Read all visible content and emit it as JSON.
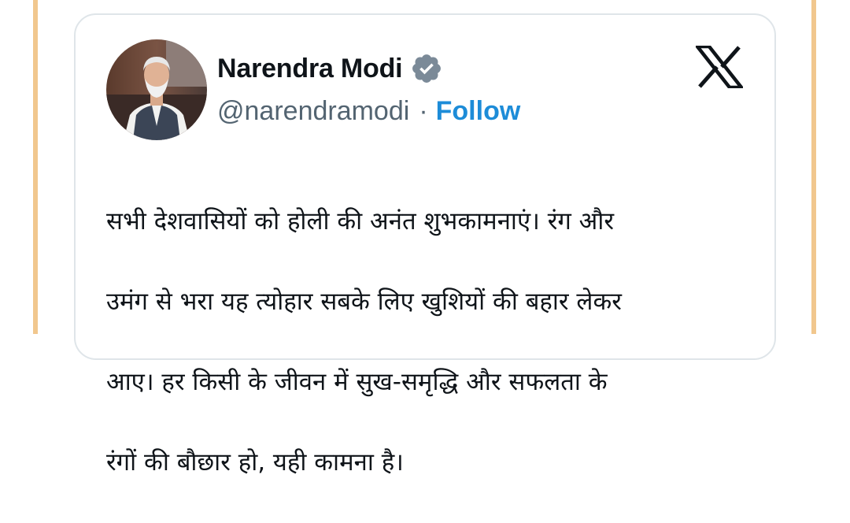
{
  "tweet": {
    "author": {
      "display_name": "Narendra Modi",
      "handle": "@narendramodi",
      "verified": true,
      "avatar_icon": "profile-photo"
    },
    "separator": "·",
    "follow_label": "Follow",
    "platform_icon": "x-logo-icon",
    "text_lines": [
      "सभी देशवासियों को होली की अनंत शुभकामनाएं। रंग और",
      "उमंग से भरा यह त्योहार सबके लिए खुशियों की बहार लेकर",
      "आए। हर किसी के जीवन में सुख-समृद्धि और सफलता के",
      "रंगों की बौछार हो, यही कामना है।"
    ]
  },
  "colors": {
    "text": "#0f1419",
    "muted": "#536471",
    "link": "#1d8cd8",
    "card_border": "#dfe5e9",
    "badge": "#7b8a98",
    "frame": "#f1c78e"
  }
}
